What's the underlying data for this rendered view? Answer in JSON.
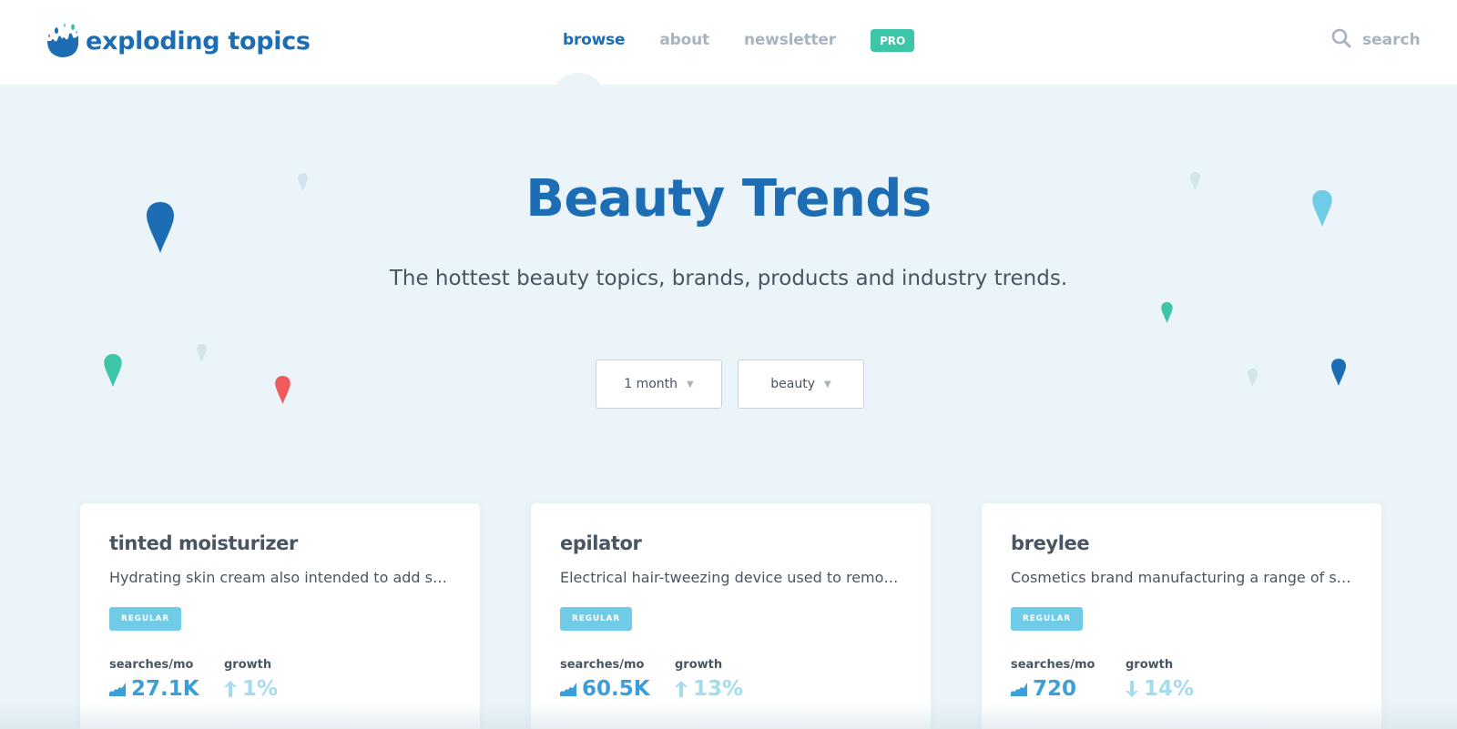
{
  "brand": {
    "name": "exploding topics"
  },
  "nav": {
    "items": [
      {
        "label": "browse",
        "active": true
      },
      {
        "label": "about",
        "active": false
      },
      {
        "label": "newsletter",
        "active": false
      }
    ],
    "pro_label": "PRO"
  },
  "search": {
    "label": "search"
  },
  "hero": {
    "title": "Beauty Trends",
    "subtitle": "The hottest beauty topics, brands, products and industry trends."
  },
  "filters": [
    {
      "value": "1 month"
    },
    {
      "value": "beauty"
    }
  ],
  "cards": [
    {
      "title": "tinted moisturizer",
      "description": "Hydrating skin cream also intended to add some color to the skin",
      "tag": "REGULAR",
      "searches_label": "searches/mo",
      "searches_value": "27.1K",
      "growth_label": "growth",
      "growth_value": "1%",
      "growth_direction": "up"
    },
    {
      "title": "epilator",
      "description": "Electrical hair-tweezing device used to remove hair from the body",
      "tag": "REGULAR",
      "searches_label": "searches/mo",
      "searches_value": "60.5K",
      "growth_label": "growth",
      "growth_value": "13%",
      "growth_direction": "up"
    },
    {
      "title": "breylee",
      "description": "Cosmetics brand manufacturing a range of skincare products",
      "tag": "REGULAR",
      "searches_label": "searches/mo",
      "searches_value": "720",
      "growth_label": "growth",
      "growth_value": "14%",
      "growth_direction": "down"
    }
  ],
  "colors": {
    "brand_blue": "#1d6db5",
    "teal": "#3dc5a8",
    "light_blue": "#6fcbe6",
    "coral": "#ef5a5a",
    "page_bg": "#ebf4f8"
  }
}
